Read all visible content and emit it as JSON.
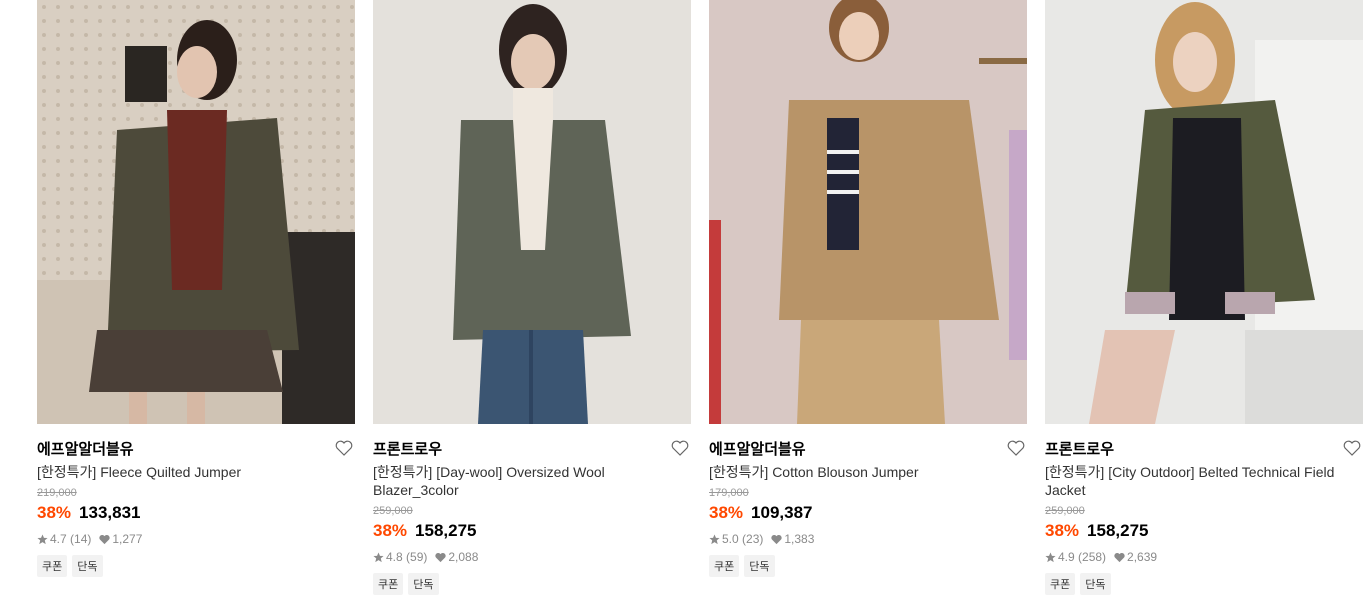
{
  "products": [
    {
      "brand": "에프알알더블유",
      "title": "[한정특가] Fleece Quilted Jumper",
      "original_price": "219,000",
      "discount": "38%",
      "price": "133,831",
      "rating": "4.7",
      "reviews": "(14)",
      "likes": "1,277",
      "tags": [
        "쿠폰",
        "단독"
      ],
      "photo_colors": {
        "bg": "#d9cfc2",
        "garment": "#4d4a3a",
        "accent": "#6b2a22"
      }
    },
    {
      "brand": "프론트로우",
      "title": "[한정특가] [Day-wool] Oversized Wool Blazer_3color",
      "original_price": "259,000",
      "discount": "38%",
      "price": "158,275",
      "rating": "4.8",
      "reviews": "(59)",
      "likes": "2,088",
      "tags": [
        "쿠폰",
        "단독"
      ],
      "photo_colors": {
        "bg": "#e4e1dc",
        "garment": "#5f6457",
        "accent": "#3b5572"
      }
    },
    {
      "brand": "에프알알더블유",
      "title": "[한정특가] Cotton Blouson Jumper",
      "original_price": "179,000",
      "discount": "38%",
      "price": "109,387",
      "rating": "5.0",
      "reviews": "(23)",
      "likes": "1,383",
      "tags": [
        "쿠폰",
        "단독"
      ],
      "photo_colors": {
        "bg": "#d8c8c4",
        "garment": "#b89468",
        "accent": "#c9a779"
      }
    },
    {
      "brand": "프론트로우",
      "title": "[한정특가] [City Outdoor] Belted Technical Field Jacket",
      "original_price": "259,000",
      "discount": "38%",
      "price": "158,275",
      "rating": "4.9",
      "reviews": "(258)",
      "likes": "2,639",
      "tags": [
        "쿠폰",
        "단독"
      ],
      "photo_colors": {
        "bg": "#e8e8e6",
        "garment": "#555a3e",
        "accent": "#1c1c22"
      }
    }
  ],
  "colors": {
    "discount": "#ff4800",
    "muted": "#8a8a8a",
    "tag_bg": "#f2f2f2"
  },
  "icons": {
    "like": "heart-outline-icon",
    "rating": "star-icon",
    "likes_count": "heart-filled-icon"
  }
}
